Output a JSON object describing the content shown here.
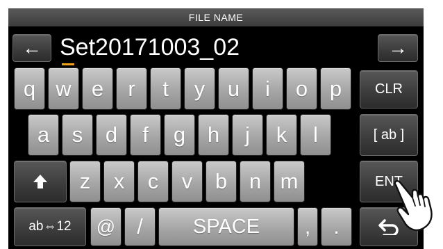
{
  "title": "FILE NAME",
  "filename": {
    "value": "Set20171003_02",
    "left_arrow": "←",
    "right_arrow": "→"
  },
  "keys": {
    "row1": [
      "q",
      "w",
      "e",
      "r",
      "t",
      "y",
      "u",
      "i",
      "o",
      "p"
    ],
    "row2": [
      "a",
      "s",
      "d",
      "f",
      "g",
      "h",
      "j",
      "k",
      "l"
    ],
    "row3": [
      "z",
      "x",
      "c",
      "v",
      "b",
      "n",
      "m"
    ],
    "clr": "CLR",
    "ab": "[ ab ]",
    "ent": "ENT",
    "shift": "shift-up-arrow-icon",
    "mode": "ab⇔12",
    "at": "@",
    "slash": "/",
    "space": "SPACE",
    "comma": ",",
    "period": ".",
    "back": "back-return-icon"
  },
  "pointer_icon": "pointing-hand-icon",
  "colors": {
    "screen_bg": "#000000",
    "key_light": "#a6a6a6",
    "key_dark": "#3b3b3b",
    "cursor": "#f2a21a",
    "title_bar": "#4a4a4a"
  }
}
